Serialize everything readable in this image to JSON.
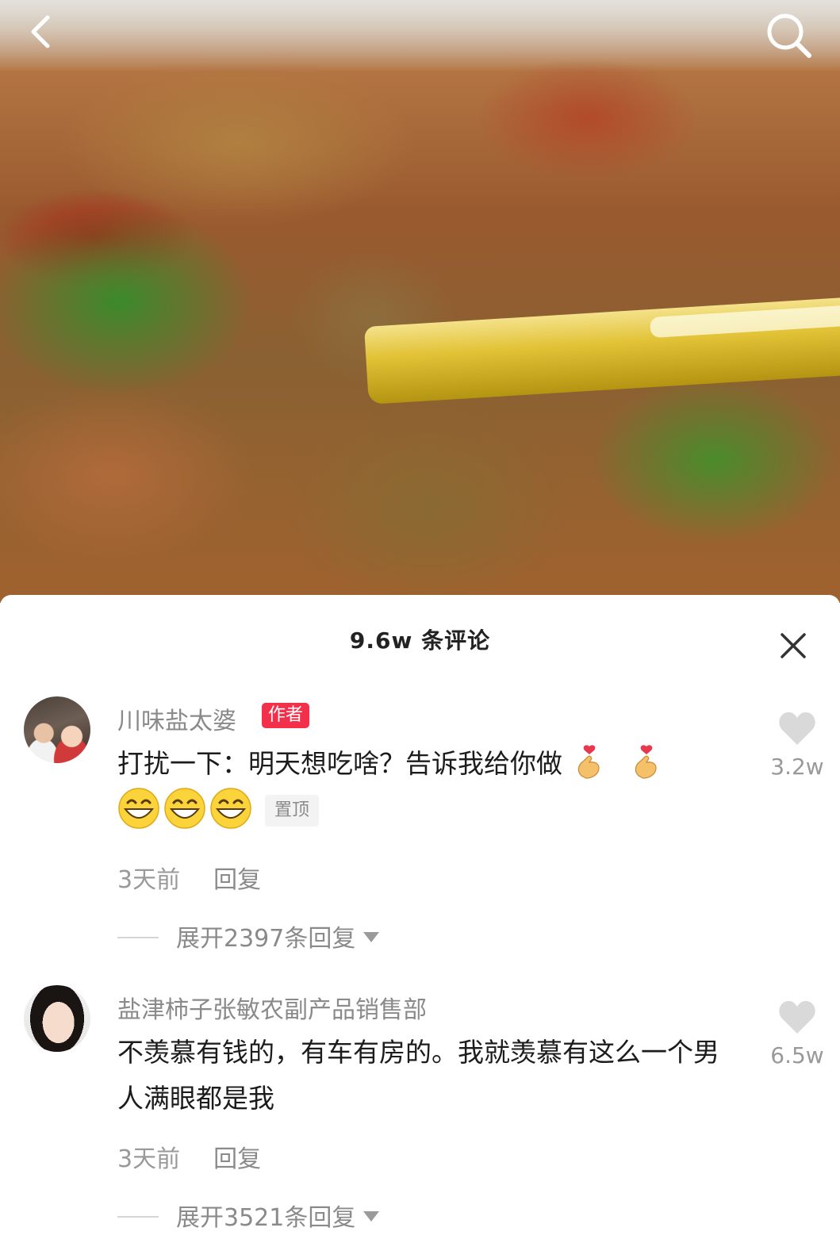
{
  "video": {
    "background_colors": {
      "sauce": "#9a5a2f",
      "greens": "#3b8a2c",
      "chopstick": "#e2c236"
    }
  },
  "nav": {
    "back_icon": "chevron-left-icon",
    "search_icon": "search-icon"
  },
  "comments_sheet": {
    "title": "9.6w 条评论",
    "close_icon": "close-icon",
    "comments": [
      {
        "username": "川味盐太婆",
        "author_badge": "作者",
        "text": "打扰一下：明天想吃啥？告诉我给你做",
        "emojis": [
          "finger-heart-emoji",
          "finger-heart-emoji",
          "grinning-emoji",
          "grinning-emoji",
          "grinning-emoji"
        ],
        "pin_label": "置顶",
        "time": "3天前",
        "reply_label": "回复",
        "expand_label": "展开2397条回复",
        "likes": "3.2w"
      },
      {
        "username": "盐津柿子张敏农副产品销售部",
        "text": "不羡慕有钱的，有车有房的。我就羡慕有这么一个男人满眼都是我",
        "time": "3天前",
        "reply_label": "回复",
        "expand_label": "展开3521条回复",
        "likes": "6.5w"
      }
    ]
  },
  "colors": {
    "author_badge": "#f3304b",
    "secondary_text": "#8a8a8a",
    "primary_text": "#1c1c1c"
  }
}
